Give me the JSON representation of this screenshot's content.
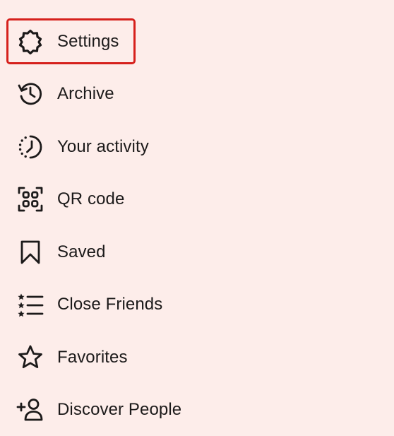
{
  "menu": {
    "items": [
      {
        "key": "settings",
        "label": "Settings",
        "icon": "gear-icon"
      },
      {
        "key": "archive",
        "label": "Archive",
        "icon": "archive-history-icon"
      },
      {
        "key": "activity",
        "label": "Your activity",
        "icon": "activity-clock-icon"
      },
      {
        "key": "qr",
        "label": "QR code",
        "icon": "qr-code-icon"
      },
      {
        "key": "saved",
        "label": "Saved",
        "icon": "bookmark-icon"
      },
      {
        "key": "close-friends",
        "label": "Close Friends",
        "icon": "star-list-icon"
      },
      {
        "key": "favorites",
        "label": "Favorites",
        "icon": "star-icon"
      },
      {
        "key": "discover",
        "label": "Discover People",
        "icon": "add-person-icon"
      }
    ]
  },
  "colors": {
    "background": "#fdedea",
    "text": "#1c1a1a",
    "highlight": "#d6201c"
  }
}
